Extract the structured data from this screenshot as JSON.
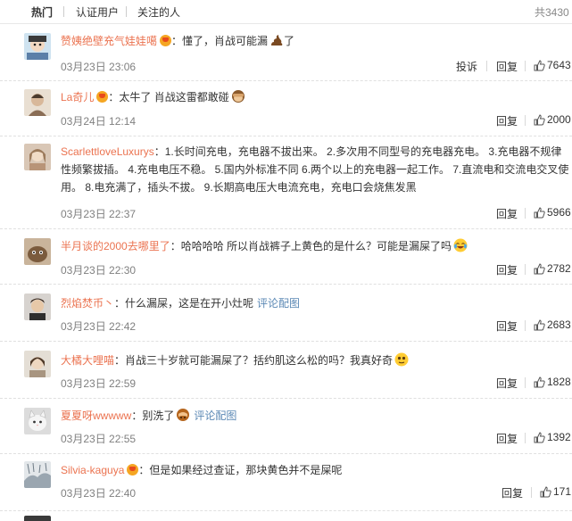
{
  "tabs": [
    {
      "label": "热门"
    },
    {
      "label": "认证用户"
    },
    {
      "label": "关注的人"
    }
  ],
  "total": "共3430",
  "comments": [
    {
      "user": "赞姨绝壁充气娃娃噶",
      "text": "：懂了，肖战可能漏",
      "text_after": "了",
      "time": "03月23日 23:06",
      "report": "投诉",
      "reply": "回复",
      "likes": "7643"
    },
    {
      "user": "La奇儿",
      "text": "：太牛了 肖战这雷都敢碰",
      "time": "03月24日 12:14",
      "reply": "回复",
      "likes": "2000"
    },
    {
      "user": "ScarlettloveLuxurys",
      "text": "：1.长时间充电，充电器不拔出来。 2.多次用不同型号的充电器充电。 3.充电器不规律性频繁拔插。 4.充电电压不稳。 5.国内外标准不同 6.两个以上的充电器一起工作。 7.直流电和交流电交叉使用。 8.电充满了，插头不拔。 9.长期高电压大电流充电，充电口会烧焦发黑",
      "time": "03月23日 22:37",
      "reply": "回复",
      "likes": "5966"
    },
    {
      "user": "半月谈的2000去哪里了",
      "text": "：哈哈哈哈 所以肖战裤子上黄色的是什么？可能是漏屎了吗",
      "time": "03月23日 22:30",
      "reply": "回复",
      "likes": "2782"
    },
    {
      "user": "烈焰焚币丶",
      "text": "：什么漏屎，这是在开小灶呢",
      "link": "评论配图",
      "time": "03月23日 22:42",
      "reply": "回复",
      "likes": "2683"
    },
    {
      "user": "大橘大哩喵",
      "text": "：肖战三十岁就可能漏屎了？括约肌这么松的吗？我真好奇",
      "time": "03月23日 22:59",
      "reply": "回复",
      "likes": "1828"
    },
    {
      "user": "夏夏呀wwwww",
      "text": "：别洗了",
      "link": "评论配图",
      "time": "03月23日 22:55",
      "reply": "回复",
      "likes": "1392"
    },
    {
      "user": "Silvia-kaguya",
      "text": "：但是如果经过查证，那块黄色并不是屎呢",
      "time": "03月23日 22:40",
      "reply": "回复",
      "likes": "171"
    }
  ]
}
